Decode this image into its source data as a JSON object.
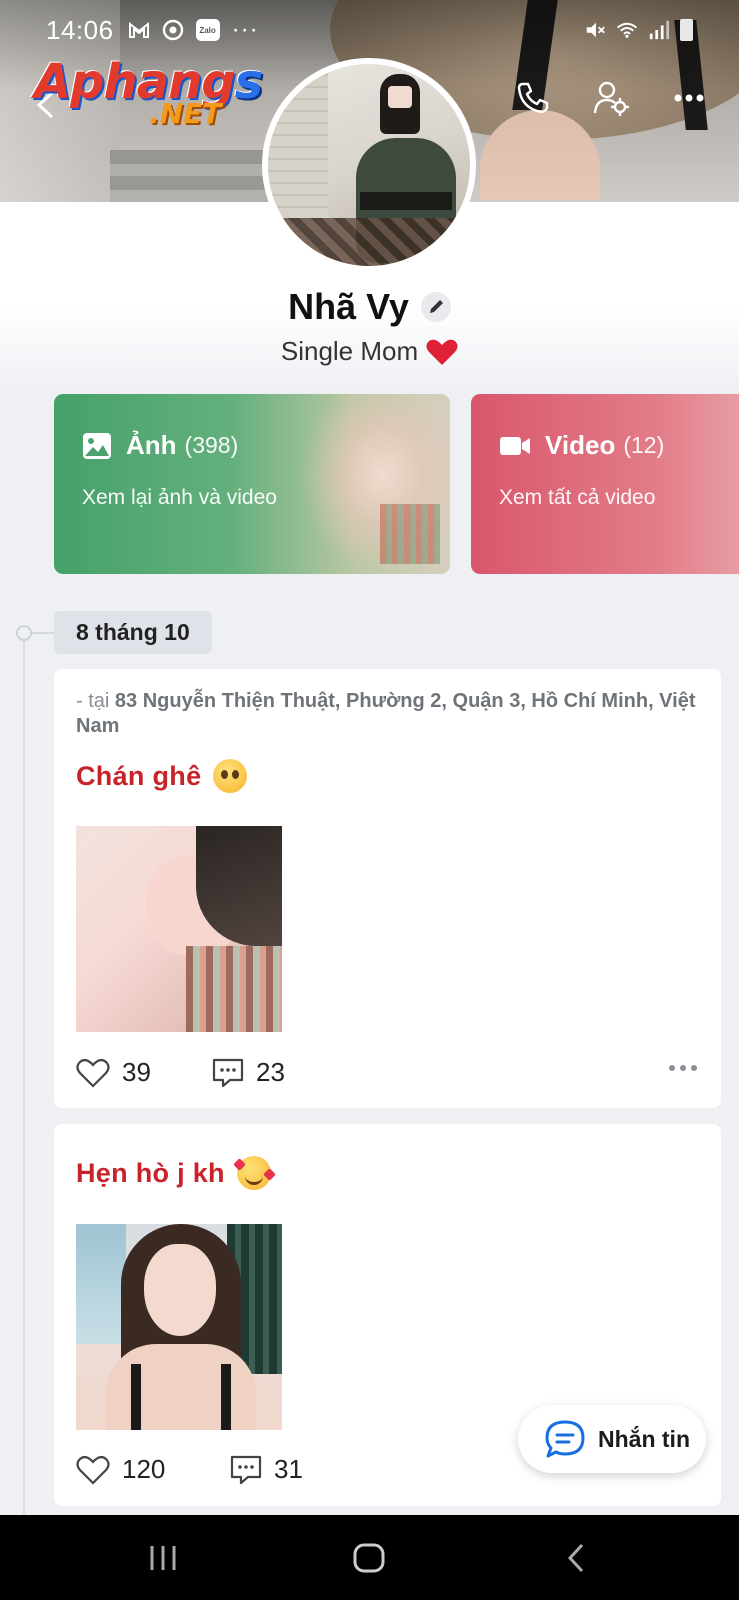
{
  "status_bar": {
    "time": "14:06",
    "icons": [
      "gmail-icon",
      "messenger-icon",
      "zalo-icon",
      "more-dots-icon"
    ],
    "zalo_label": "Zalo",
    "dots": "···",
    "right_icons": [
      "mute-icon",
      "wifi-icon",
      "signal-icon",
      "battery-icon"
    ]
  },
  "watermark": {
    "line1_red": "Aphang",
    "line1_blue": "s",
    "line2": ".NET"
  },
  "header": {
    "actions": [
      "back-icon",
      "call-icon",
      "profile-settings-icon",
      "more-icon"
    ]
  },
  "profile": {
    "name": "Nhã Vy",
    "bio": "Single Mom",
    "bio_emoji": "heart"
  },
  "media_cards": {
    "photos": {
      "title": "Ảnh",
      "count": "(398)",
      "subtitle": "Xem lại ảnh và video"
    },
    "videos": {
      "title": "Video",
      "count": "(12)",
      "subtitle": "Xem tất cả video"
    }
  },
  "timeline": {
    "date_label": "8 tháng 10",
    "posts": [
      {
        "location_prefix": " - tại ",
        "location": "83 Nguyễn Thiện Thuật, Phường 2, Quận 3, Hồ Chí Minh, Việt Nam",
        "text": "Chán ghê",
        "emoji": "pleading-face",
        "likes": "39",
        "comments": "23"
      },
      {
        "text": "Hẹn hò j kh",
        "emoji": "smiling-face-with-hearts",
        "likes": "120",
        "comments": "31"
      }
    ]
  },
  "chat_fab": {
    "label": "Nhắn tin"
  },
  "colors": {
    "accent_blue": "#1a6fe0",
    "photos_card": "#45a06a",
    "videos_card": "#d9576c",
    "post_text": "#c8222a"
  }
}
